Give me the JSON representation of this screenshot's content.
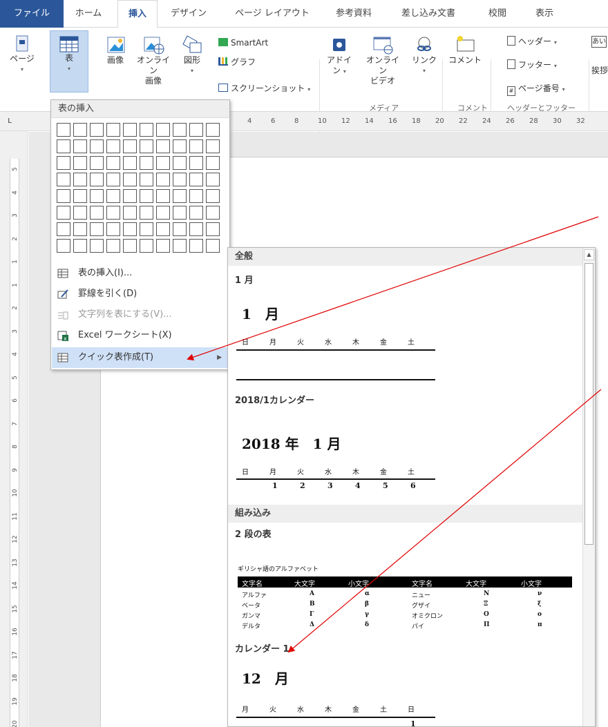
{
  "tabs": [
    "ファイル",
    "ホーム",
    "挿入",
    "デザイン",
    "ページ レイアウト",
    "参考資料",
    "差し込み文書",
    "校閲",
    "表示"
  ],
  "ribbon": {
    "page_label": "ページ",
    "table_label": "表",
    "image_label": "画像",
    "online_image_label_1": "オンライン",
    "online_image_label_2": "画像",
    "shapes_label": "図形",
    "smartart_label": "SmartArt",
    "graph_label": "グラフ",
    "screenshot_label": "スクリーンショット",
    "addin_label_1": "アドイ",
    "addin_label_2": "ン",
    "online_video_label_1": "オンライン",
    "online_video_label_2": "ビデオ",
    "link_label": "リンク",
    "comment_label": "コメント",
    "header_label": "ヘッダー",
    "footer_label": "フッター",
    "page_number_label": "ページ番号",
    "greeting_label_1": "あい",
    "greeting_label_2": "挨拶",
    "group_media": "メディア",
    "group_comment": "コメント",
    "group_header_footer": "ヘッダーとフッター"
  },
  "ruler": {
    "corner": "L",
    "h_ticks": [
      "4",
      "6",
      "8",
      "10",
      "12",
      "14",
      "16",
      "18",
      "20",
      "22",
      "24",
      "26",
      "28",
      "30",
      "32"
    ],
    "v_ticks": [
      "5",
      "4",
      "3",
      "2",
      "1",
      "1",
      "2",
      "3",
      "4",
      "5",
      "6",
      "7",
      "8",
      "9",
      "10",
      "11",
      "12",
      "13",
      "14",
      "15",
      "16",
      "17",
      "18",
      "19",
      "20"
    ]
  },
  "table_menu": {
    "title": "表の挿入",
    "grid_cols": 10,
    "grid_rows": 8,
    "items": [
      {
        "label": "表の挿入(I)...",
        "enabled": true
      },
      {
        "label": "罫線を引く(D)",
        "enabled": true
      },
      {
        "label": "文字列を表にする(V)...",
        "enabled": false
      },
      {
        "label": "Excel ワークシート(X)",
        "enabled": true
      },
      {
        "label": "クイック表作成(T)",
        "enabled": true,
        "highlighted": true
      }
    ]
  },
  "gallery": {
    "section_general": "全般",
    "item1_label": "1 月",
    "item1_title": "1　月",
    "days_sun_first": [
      "日",
      "月",
      "火",
      "水",
      "木",
      "金",
      "土"
    ],
    "item2_label": "2018/1カレンダー",
    "item2_title": "2018 年　1 月",
    "item2_numbers": [
      "1",
      "2",
      "3",
      "4",
      "5",
      "6"
    ],
    "section_builtin": "組み込み",
    "item3_label": "2 段の表",
    "greek": {
      "caption": "ギリシャ語のアルファベット",
      "headers": [
        "文字名",
        "大文字",
        "小文字",
        "文字名",
        "大文字",
        "小文字"
      ],
      "rows": [
        [
          "アルファ",
          "A",
          "α",
          "ニュー",
          "N",
          "ν"
        ],
        [
          "ベータ",
          "B",
          "β",
          "グザイ",
          "Ξ",
          "ξ"
        ],
        [
          "ガンマ",
          "Γ",
          "γ",
          "オミクロン",
          "O",
          "ο"
        ],
        [
          "デルタ",
          "Δ",
          "δ",
          "パイ",
          "Π",
          "π"
        ]
      ]
    },
    "item4_label": "カレンダー 1",
    "item4_title": "12　月",
    "days_mon_first": [
      "月",
      "火",
      "水",
      "木",
      "金",
      "土",
      "日"
    ],
    "item4_first_number": "1"
  },
  "colors": {
    "file_tab": "#2b579a",
    "selected_button": "#c5d9f1",
    "menu_highlight": "#cfe1f7",
    "arrow": "#e00000"
  }
}
